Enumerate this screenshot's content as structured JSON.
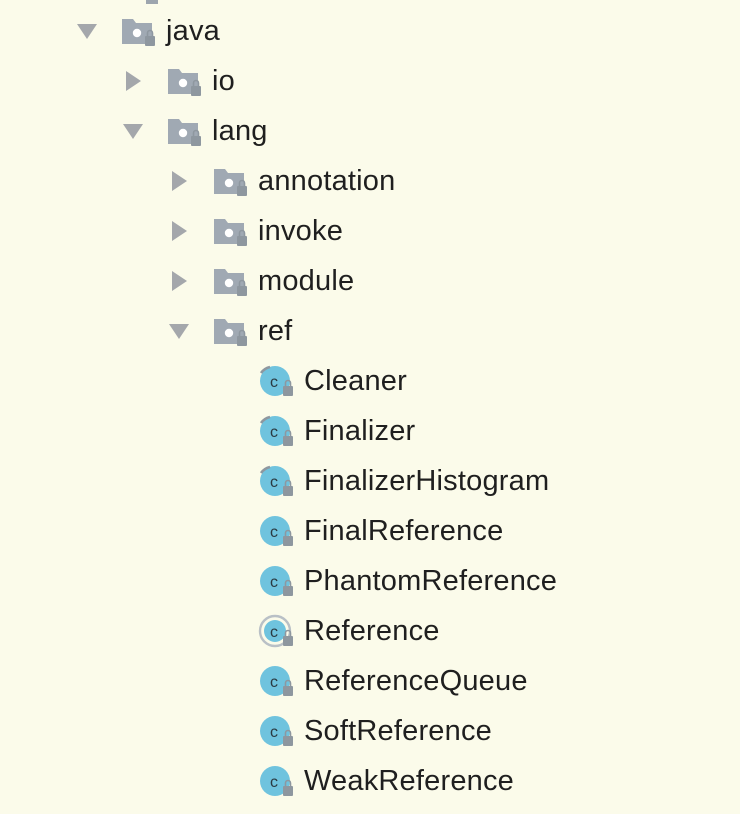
{
  "tree": {
    "nodes": [
      {
        "label": "java",
        "type": "package",
        "expanded": true,
        "level": 0,
        "has_toggle": true
      },
      {
        "label": "io",
        "type": "package",
        "expanded": false,
        "level": 1,
        "has_toggle": true
      },
      {
        "label": "lang",
        "type": "package",
        "expanded": true,
        "level": 1,
        "has_toggle": true
      },
      {
        "label": "annotation",
        "type": "package",
        "expanded": false,
        "level": 2,
        "has_toggle": true
      },
      {
        "label": "invoke",
        "type": "package",
        "expanded": false,
        "level": 2,
        "has_toggle": true
      },
      {
        "label": "module",
        "type": "package",
        "expanded": false,
        "level": 2,
        "has_toggle": true
      },
      {
        "label": "ref",
        "type": "package",
        "expanded": true,
        "level": 2,
        "has_toggle": true
      },
      {
        "label": "Cleaner",
        "type": "class",
        "variant": "final",
        "level": 3,
        "has_toggle": false
      },
      {
        "label": "Finalizer",
        "type": "class",
        "variant": "final",
        "level": 3,
        "has_toggle": false
      },
      {
        "label": "FinalizerHistogram",
        "type": "class",
        "variant": "final",
        "level": 3,
        "has_toggle": false
      },
      {
        "label": "FinalReference",
        "type": "class",
        "variant": "plain",
        "level": 3,
        "has_toggle": false
      },
      {
        "label": "PhantomReference",
        "type": "class",
        "variant": "plain",
        "level": 3,
        "has_toggle": false
      },
      {
        "label": "Reference",
        "type": "class",
        "variant": "abstract",
        "level": 3,
        "has_toggle": false
      },
      {
        "label": "ReferenceQueue",
        "type": "class",
        "variant": "plain",
        "level": 3,
        "has_toggle": false
      },
      {
        "label": "SoftReference",
        "type": "class",
        "variant": "plain",
        "level": 3,
        "has_toggle": false
      },
      {
        "label": "WeakReference",
        "type": "class",
        "variant": "plain",
        "level": 3,
        "has_toggle": false
      }
    ]
  },
  "colors": {
    "background": "#FBFBEA",
    "text": "#1F1F1F",
    "toggle": "#A4A7AB",
    "folder": "#A0A9B3",
    "class_fill": "#6FC3DE",
    "lock": "#8E979F"
  },
  "icons": {
    "package": "package-folder-icon",
    "class": "class-icon",
    "expanded": "triangle-down-icon",
    "collapsed": "triangle-right-icon"
  }
}
